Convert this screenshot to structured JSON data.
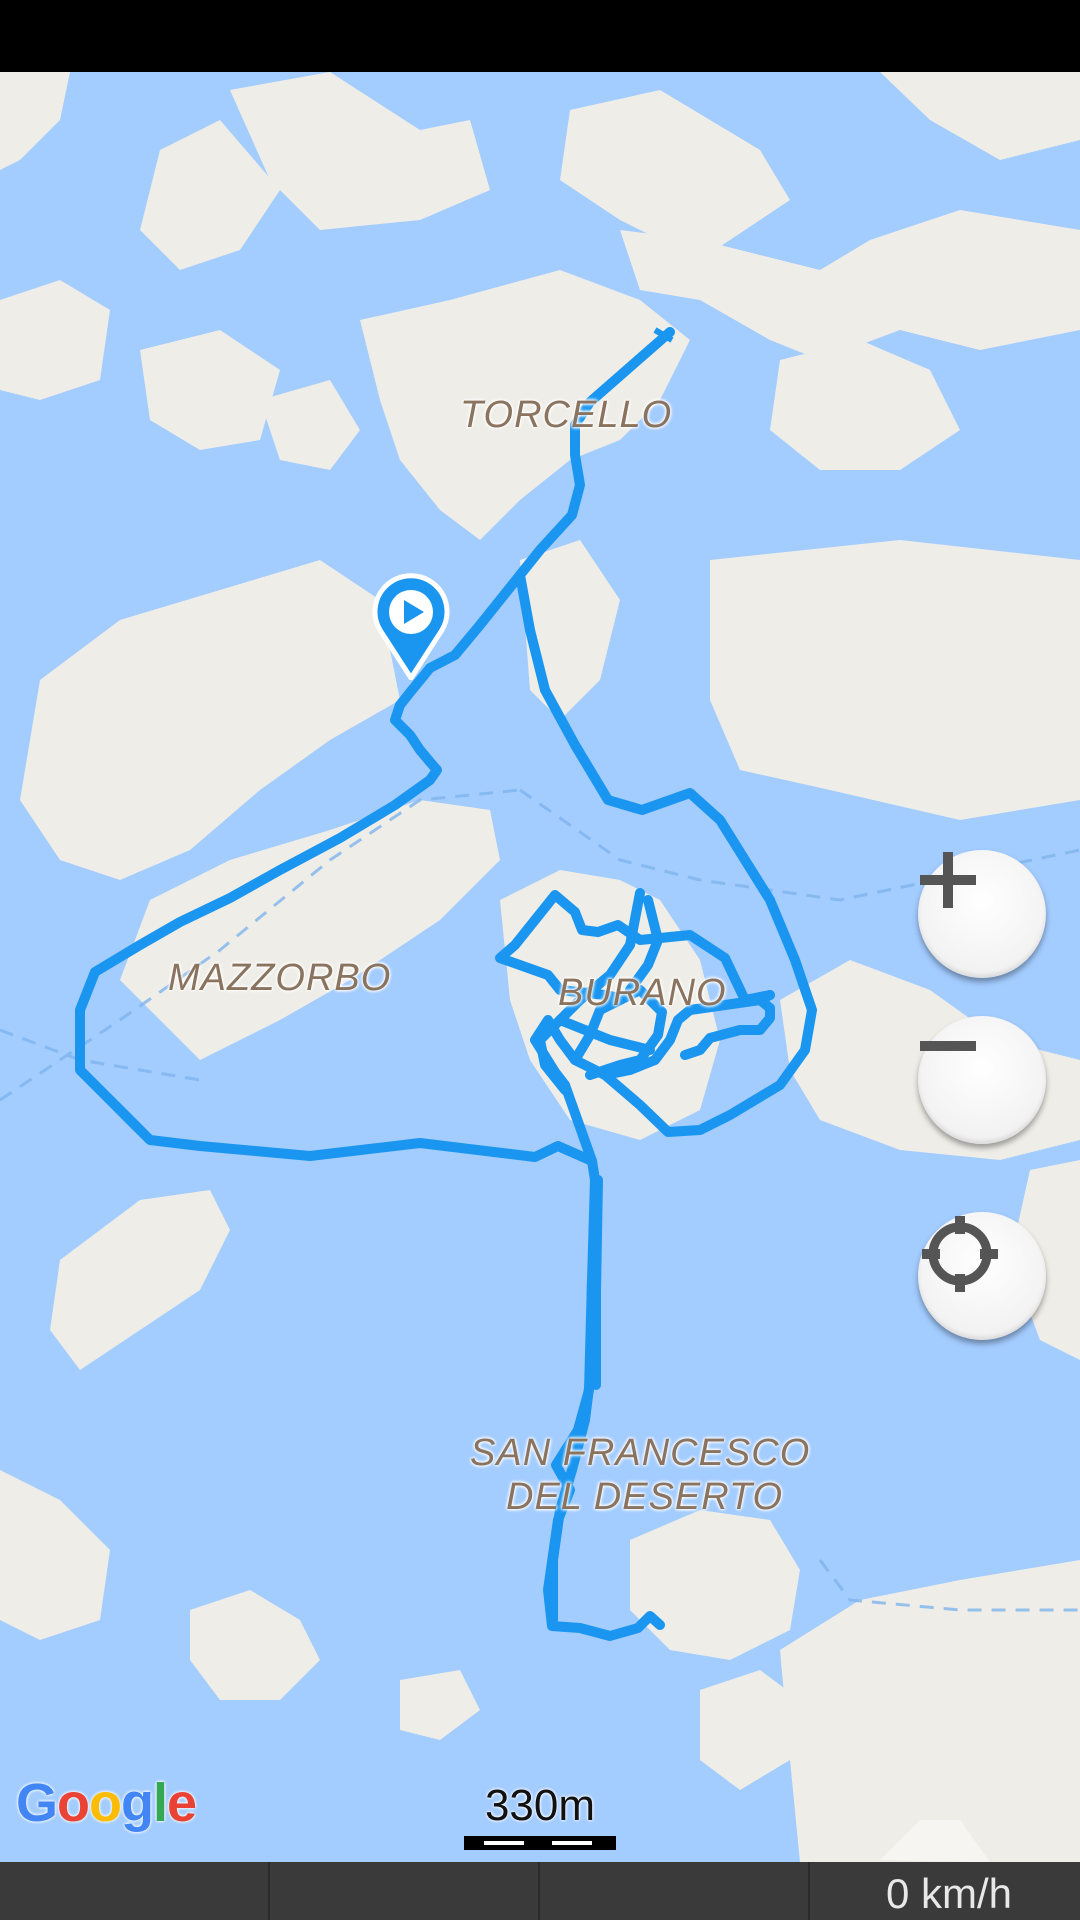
{
  "map": {
    "place_labels": {
      "torcello": "TORCELLO",
      "mazzorbo": "MAZZORBO",
      "burano": "BURANO",
      "san_francesco_line1": "SAN FRANCESCO",
      "san_francesco_line2": "DEL DESERTO"
    },
    "provider_logo": "Google",
    "scale_label": "330m",
    "controls": {
      "zoom_in_icon": "plus-icon",
      "zoom_out_icon": "minus-icon",
      "my_location_icon": "crosshair-icon"
    },
    "start_marker_icon": "play-icon",
    "colors": {
      "water": "#a3ccff",
      "land": "#efede7",
      "track": "#1a96f0",
      "label": "#8a735f"
    }
  },
  "status": {
    "speed": "0 km/h"
  }
}
